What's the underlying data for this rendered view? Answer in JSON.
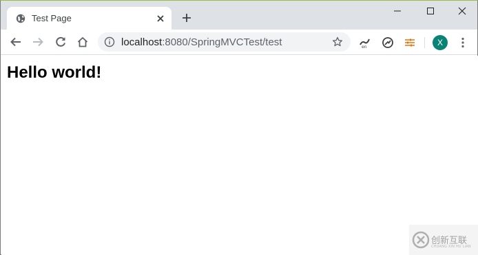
{
  "tab": {
    "title": "Test Page",
    "favicon": "globe-icon",
    "close_icon": "close-icon",
    "new_tab_icon": "plus-icon"
  },
  "window_controls": [
    "minimize-icon",
    "maximize-icon",
    "close-icon"
  ],
  "toolbar": {
    "back_icon": "arrow-left-icon",
    "forward_icon": "arrow-right-icon",
    "reload_icon": "reload-icon",
    "home_icon": "home-icon",
    "url_host": "localhost",
    "url_path": ":8080/SpringMVCTest/test",
    "info_icon": "info-icon",
    "bookmark_icon": "star-icon",
    "extensions": [
      "translate-extension-icon",
      "speed-extension-icon",
      "settings-sliders-extension-icon"
    ],
    "profile_initial": "X",
    "menu_icon": "more-vertical-icon"
  },
  "page": {
    "heading": "Hello world!"
  },
  "watermark": {
    "text": "创新互联",
    "subtext": "CHUANG XIN HU LIAN"
  },
  "colors": {
    "tabstrip": "#dee1e6",
    "omnibox": "#f1f3f4",
    "avatar": "#0b8276",
    "accent_orange": "#e8710a"
  }
}
